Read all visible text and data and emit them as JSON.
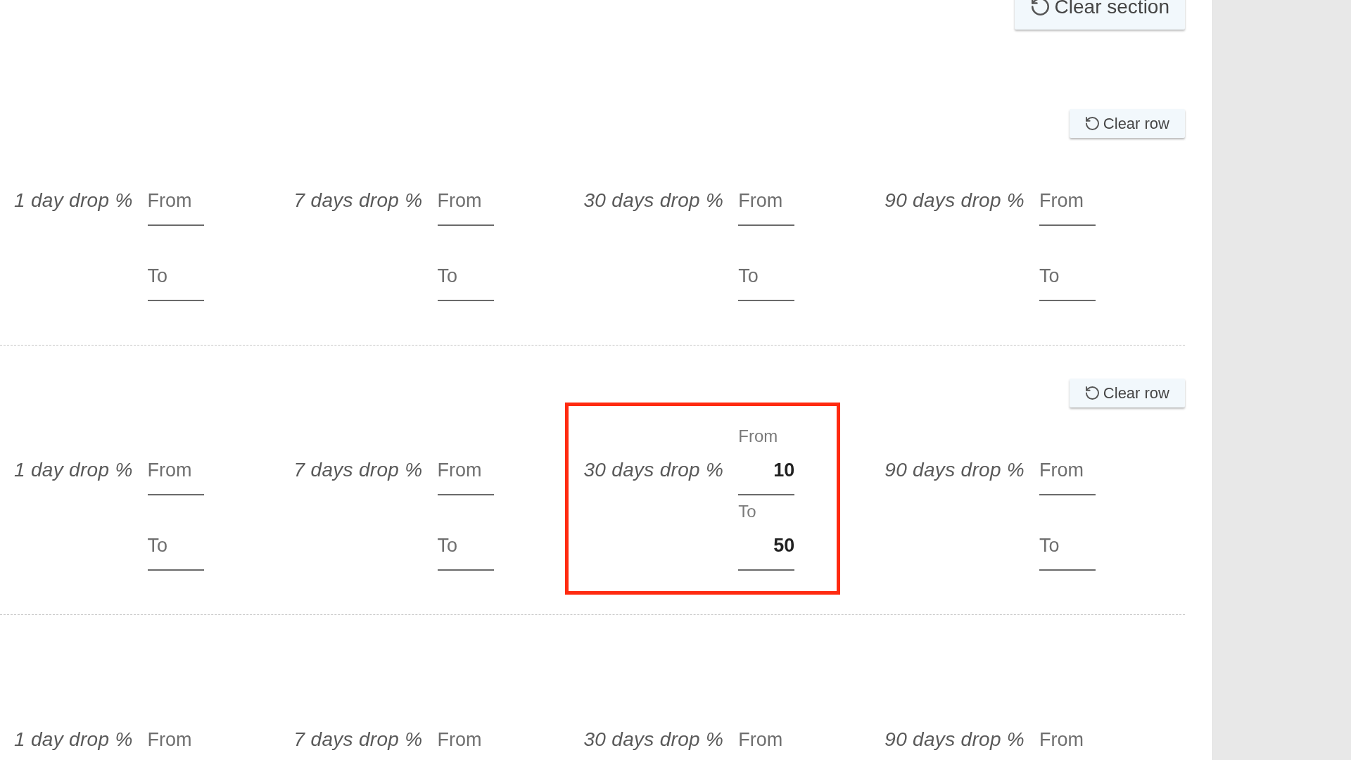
{
  "clear_section_button": {
    "label": "Clear section"
  },
  "rows": [
    {
      "clear_button": {
        "label": "Clear row"
      },
      "groups": [
        {
          "label": "1 day drop %",
          "highlighted": false,
          "fields": [
            {
              "placeholder": "From"
            },
            {
              "placeholder": "To"
            }
          ]
        },
        {
          "label": "7 days drop %",
          "highlighted": false,
          "fields": [
            {
              "placeholder": "From"
            },
            {
              "placeholder": "To"
            }
          ]
        },
        {
          "label": "30 days drop %",
          "highlighted": false,
          "fields": [
            {
              "placeholder": "From"
            },
            {
              "placeholder": "To"
            }
          ]
        },
        {
          "label": "90 days drop %",
          "highlighted": false,
          "fields": [
            {
              "placeholder": "From"
            },
            {
              "placeholder": "To"
            }
          ]
        }
      ]
    },
    {
      "clear_button": {
        "label": "Clear row"
      },
      "groups": [
        {
          "label": "1 day drop %",
          "highlighted": false,
          "fields": [
            {
              "placeholder": "From"
            },
            {
              "placeholder": "To"
            }
          ]
        },
        {
          "label": "7 days drop %",
          "highlighted": false,
          "fields": [
            {
              "placeholder": "From"
            },
            {
              "placeholder": "To"
            }
          ]
        },
        {
          "label": "30 days drop %",
          "highlighted": true,
          "fields": [
            {
              "label": "From",
              "value": "10"
            },
            {
              "label": "To",
              "value": "50"
            }
          ]
        },
        {
          "label": "90 days drop %",
          "highlighted": false,
          "fields": [
            {
              "placeholder": "From"
            },
            {
              "placeholder": "To"
            }
          ]
        }
      ]
    },
    {
      "groups": [
        {
          "label": "1 day drop %",
          "highlighted": false,
          "fields": [
            {
              "placeholder": "From"
            }
          ]
        },
        {
          "label": "7 days drop %",
          "highlighted": false,
          "fields": [
            {
              "placeholder": "From"
            }
          ]
        },
        {
          "label": "30 days drop %",
          "highlighted": false,
          "fields": [
            {
              "placeholder": "From"
            }
          ]
        },
        {
          "label": "90 days drop %",
          "highlighted": false,
          "fields": [
            {
              "placeholder": "From"
            }
          ]
        }
      ]
    }
  ]
}
